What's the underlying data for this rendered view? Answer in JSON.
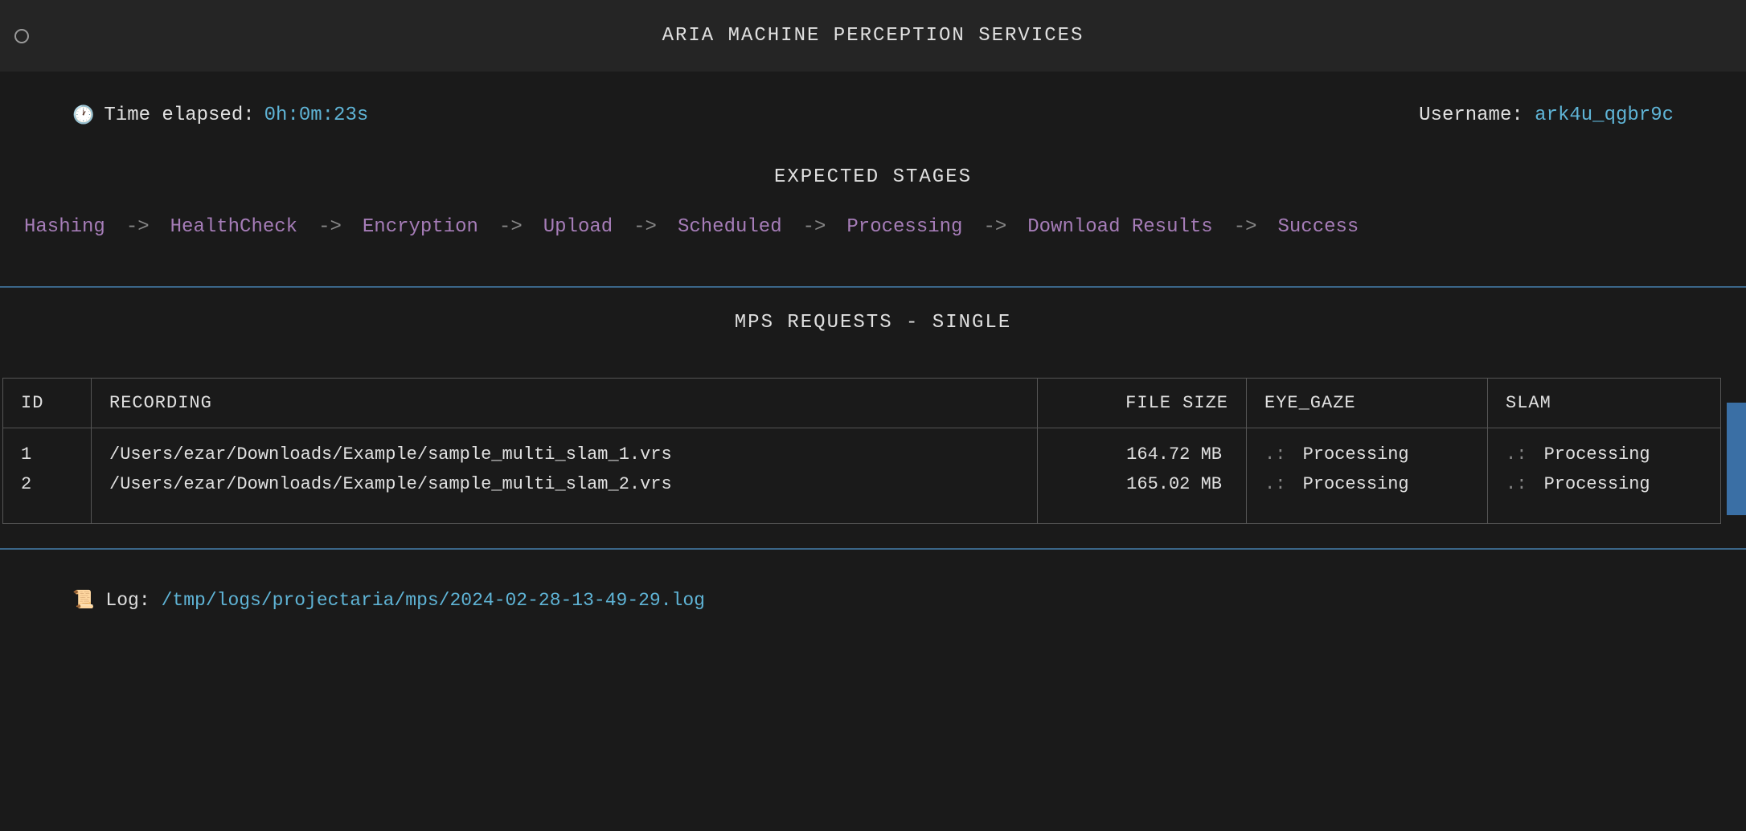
{
  "title": "ARIA MACHINE PERCEPTION SERVICES",
  "info": {
    "time_elapsed_label": "Time elapsed:",
    "time_elapsed_value": "0h:0m:23s",
    "username_label": "Username:",
    "username_value": "ark4u_qgbr9c"
  },
  "stages": {
    "header": "EXPECTED STAGES",
    "items": [
      "Hashing",
      "HealthCheck",
      "Encryption",
      "Upload",
      "Scheduled",
      "Processing",
      "Download Results",
      "Success"
    ],
    "arrow": "->"
  },
  "requests": {
    "header": "MPS REQUESTS - SINGLE",
    "columns": {
      "id": "ID",
      "recording": "RECORDING",
      "filesize": "FILE SIZE",
      "eyegaze": "EYE_GAZE",
      "slam": "SLAM"
    },
    "rows": [
      {
        "id": "1",
        "recording": "/Users/ezar/Downloads/Example/sample_multi_slam_1.vrs",
        "filesize": "164.72 MB",
        "eyegaze_status": "Processing",
        "slam_status": "Processing"
      },
      {
        "id": "2",
        "recording": "/Users/ezar/Downloads/Example/sample_multi_slam_2.vrs",
        "filesize": "165.02 MB",
        "eyegaze_status": "Processing",
        "slam_status": "Processing"
      }
    ],
    "status_prefix": ".:"
  },
  "log": {
    "label": "Log:",
    "path": "/tmp/logs/projectaria/mps/2024-02-28-13-49-29.log"
  }
}
